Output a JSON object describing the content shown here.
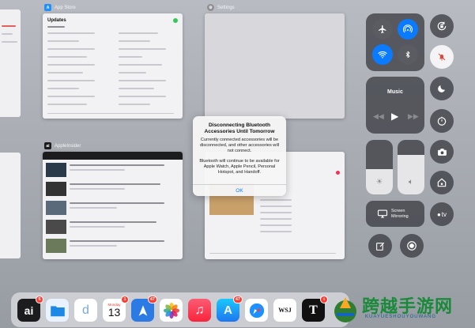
{
  "switcher": {
    "app_store_label": "App Store",
    "settings_label": "Settings",
    "appleinsider_label": "AppleInsider",
    "app_store_card_title": "Updates"
  },
  "control_center": {
    "music_label": "Music",
    "screen_mirroring_label": "Screen\nMirroring",
    "apple_tv_label": "tv"
  },
  "alert": {
    "title": "Disconnecting Bluetooth Accessories Until Tomorrow",
    "message1": "Currently connected accessories will be disconnected, and other accessories will not connect.",
    "message2": "Bluetooth will continue to be available for Apple Watch, Apple Pencil, Personal Hotspot, and Handoff.",
    "button": "OK"
  },
  "dock": {
    "icons": [
      {
        "name": "appleinsider",
        "label": "ai",
        "color": "#1c1c1e",
        "badge": "5"
      },
      {
        "name": "files",
        "label": "",
        "color": "#1e88e5",
        "badge": ""
      },
      {
        "name": "dictionary",
        "label": "d",
        "color": "#ffffff",
        "badge": ""
      },
      {
        "name": "calendar",
        "day": "Monday",
        "date": "13",
        "color": "#ffffff",
        "badge": "1"
      },
      {
        "name": "spark",
        "label": "",
        "color": "#2c7be5",
        "badge": "47"
      },
      {
        "name": "photos",
        "label": "",
        "color": "#ffffff",
        "badge": ""
      },
      {
        "name": "music",
        "label": "♫",
        "color": "#fa2d55",
        "badge": ""
      },
      {
        "name": "app-store",
        "label": "A",
        "color": "#1e90ff",
        "badge": "47"
      },
      {
        "name": "safari",
        "label": "",
        "color": "#ffffff",
        "badge": ""
      },
      {
        "name": "wsj",
        "label": "WSJ",
        "color": "#ffffff",
        "badge": ""
      },
      {
        "name": "nytimes",
        "label": "T",
        "color": "#111111",
        "badge": "1"
      }
    ]
  },
  "watermark": {
    "text": "跨越手游网",
    "sub": "KUAYUESHOUYOUWANG"
  },
  "colors": {
    "accent_blue": "#0a7aff",
    "badge_red": "#ff3b30",
    "bell_red": "#e0453b"
  }
}
